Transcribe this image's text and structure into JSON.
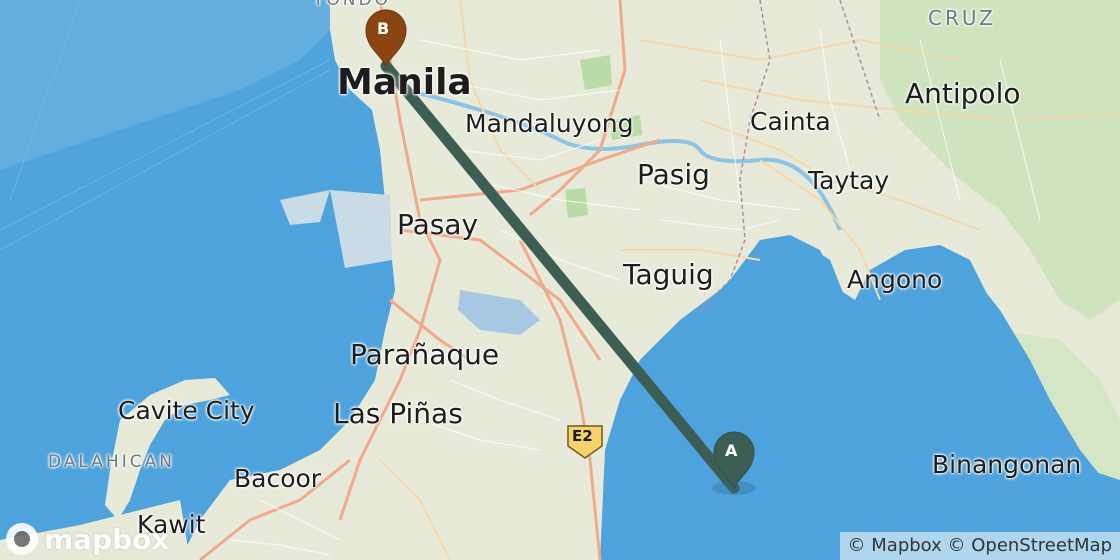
{
  "map": {
    "places": [
      {
        "key": "manila",
        "label": "Manila"
      },
      {
        "key": "mandaluyong",
        "label": "Mandaluyong"
      },
      {
        "key": "cainta",
        "label": "Cainta"
      },
      {
        "key": "antipolo",
        "label": "Antipolo"
      },
      {
        "key": "pasig",
        "label": "Pasig"
      },
      {
        "key": "taytay",
        "label": "Taytay"
      },
      {
        "key": "pasay",
        "label": "Pasay"
      },
      {
        "key": "taguig",
        "label": "Taguig"
      },
      {
        "key": "angono",
        "label": "Angono"
      },
      {
        "key": "paranaque",
        "label": "Parañaque"
      },
      {
        "key": "cavite_city",
        "label": "Cavite City"
      },
      {
        "key": "las_pinas",
        "label": "Las Piñas"
      },
      {
        "key": "dalahican",
        "label": "DALAHICAN"
      },
      {
        "key": "bacoor",
        "label": "Bacoor"
      },
      {
        "key": "binangonan",
        "label": "Binangonan"
      },
      {
        "key": "kawit",
        "label": "Kawit"
      },
      {
        "key": "cruz",
        "label": "CRUZ"
      },
      {
        "key": "tondo",
        "label": "TONDO"
      }
    ],
    "road_shield": {
      "label": "E2"
    },
    "markers": [
      {
        "label": "A",
        "color": "#3d5e54"
      },
      {
        "label": "B",
        "color": "#8b4513"
      }
    ],
    "route": {
      "color": "#3d5e54"
    }
  },
  "logo": {
    "text": "mapbox"
  },
  "attribution": {
    "text": "© Mapbox © OpenStreetMap"
  }
}
